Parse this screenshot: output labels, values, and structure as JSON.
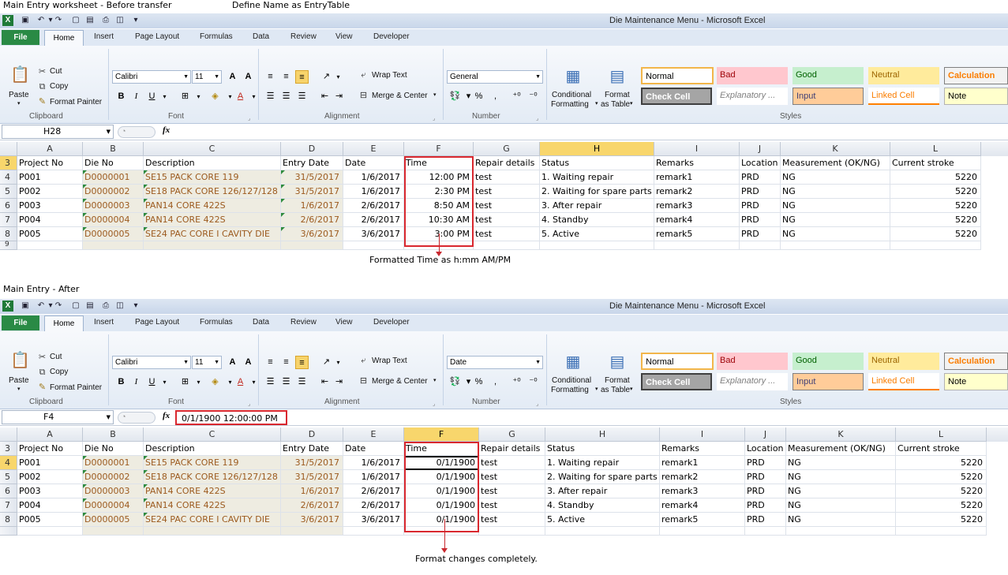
{
  "captions": {
    "top_left": "Main Entry worksheet - Before transfer",
    "top_mid": "Define Name as EntryTable",
    "mid": "Main Entry - After"
  },
  "window_title": "Die Maintenance Menu  -  Microsoft Excel",
  "tabs": [
    "File",
    "Home",
    "Insert",
    "Page Layout",
    "Formulas",
    "Data",
    "Review",
    "View",
    "Developer"
  ],
  "ribbon": {
    "paste": "Paste",
    "cut": "Cut",
    "copy": "Copy",
    "format_painter": "Format Painter",
    "clipboard": "Clipboard",
    "font_name": "Calibri",
    "font_size": "11",
    "font": "Font",
    "wrap_text": "Wrap Text",
    "merge_center": "Merge & Center",
    "alignment": "Alignment",
    "number": "Number",
    "conditional": "Conditional",
    "formatting": "Formatting",
    "format": "Format",
    "as_table": "as Table",
    "styles": "Styles",
    "style_cells": [
      "Normal",
      "Bad",
      "Good",
      "Neutral",
      "Calculation",
      "Check Cell",
      "Explanatory ...",
      "Input",
      "Linked Cell",
      "Note"
    ],
    "style_colors": {
      "bad": "#ffc7ce",
      "good": "#c6efce",
      "neutral": "#ffeb9c",
      "calc": "#f2f2f2",
      "check": "#a5a5a5",
      "input": "#ffcc99",
      "note": "#ffffcc"
    }
  },
  "before": {
    "number_format": "General",
    "name_box": "H28",
    "formula": "",
    "note": "Formatted Time as h:mm AM/PM",
    "time_values": [
      "12:00 PM",
      "2:30 PM",
      "8:50 AM",
      "10:30 AM",
      "3:00 PM"
    ],
    "row9": "9"
  },
  "after": {
    "number_format": "Date",
    "name_box": "F4",
    "formula": "0/1/1900  12:00:00 PM",
    "note": "Format changes completely.",
    "time_values": [
      "0/1/1900",
      "0/1/1900",
      "0/1/1900",
      "0/1/1900",
      "0/1/1900"
    ]
  },
  "columns": [
    "A",
    "B",
    "C",
    "D",
    "E",
    "F",
    "G",
    "H",
    "I",
    "J",
    "K",
    "L"
  ],
  "headers": [
    "Project No",
    "Die No",
    "Description",
    "Entry Date",
    "Date",
    "Time",
    "Repair details",
    "Status",
    "Remarks",
    "Location",
    "Measurement (OK/NG)",
    "Current stroke"
  ],
  "row_numbers": [
    "3",
    "4",
    "5",
    "6",
    "7",
    "8"
  ],
  "rows": [
    {
      "project": "P001",
      "die": "D0000001",
      "desc": "SE15 PACK CORE 119",
      "entry": "31/5/2017",
      "date": "1/6/2017",
      "repair": "test",
      "status": "1. Waiting repair",
      "remarks": "remark1",
      "loc": "PRD",
      "meas": "NG",
      "stroke": "5220"
    },
    {
      "project": "P002",
      "die": "D0000002",
      "desc": "SE18 PACK CORE 126/127/128",
      "entry": "31/5/2017",
      "date": "1/6/2017",
      "repair": "test",
      "status": "2. Waiting for spare parts",
      "remarks": "remark2",
      "loc": "PRD",
      "meas": "NG",
      "stroke": "5220"
    },
    {
      "project": "P003",
      "die": "D0000003",
      "desc": "PAN14 CORE 422S",
      "entry": "1/6/2017",
      "date": "2/6/2017",
      "repair": "test",
      "status": "3. After repair",
      "remarks": "remark3",
      "loc": "PRD",
      "meas": "NG",
      "stroke": "5220"
    },
    {
      "project": "P004",
      "die": "D0000004",
      "desc": "PAN14 CORE 422S",
      "entry": "2/6/2017",
      "date": "2/6/2017",
      "repair": "test",
      "status": "4. Standby",
      "remarks": "remark4",
      "loc": "PRD",
      "meas": "NG",
      "stroke": "5220"
    },
    {
      "project": "P005",
      "die": "D0000005",
      "desc": "SE24 PAC CORE I CAVITY DIE",
      "entry": "3/6/2017",
      "date": "3/6/2017",
      "repair": "test",
      "status": "5. Active",
      "remarks": "remark5",
      "loc": "PRD",
      "meas": "NG",
      "stroke": "5220"
    }
  ]
}
